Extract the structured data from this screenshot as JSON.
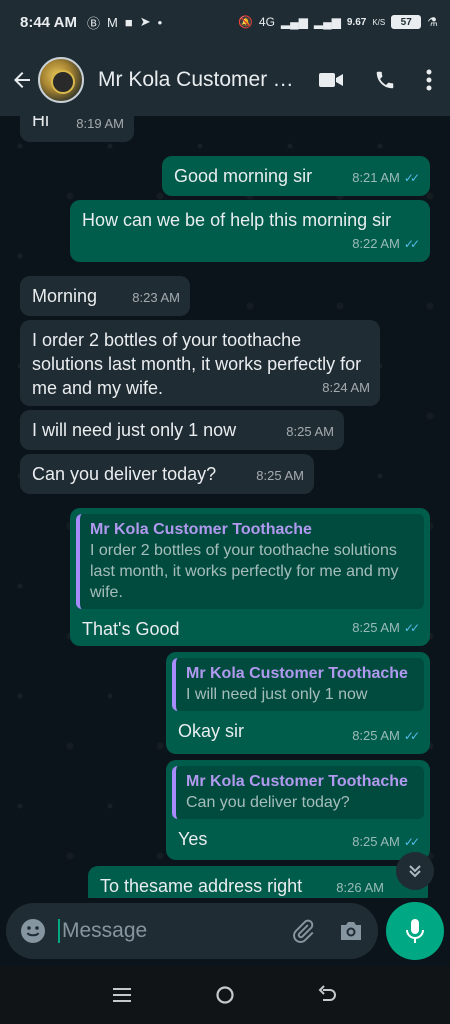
{
  "status_bar": {
    "time": "8:44 AM",
    "left_icons": [
      "b-icon",
      "gmail-icon",
      "square-icon",
      "telegram-icon",
      "dot-icon"
    ],
    "network_label": "4G",
    "speed_value": "9.67",
    "speed_unit": "K/S",
    "battery": "57"
  },
  "header": {
    "contact_name": "Mr Kola Customer Toothache",
    "icons": [
      "back-arrow-icon",
      "video-call-icon",
      "voice-call-icon",
      "more-options-icon"
    ]
  },
  "messages": [
    {
      "direction": "in",
      "text": "Hi",
      "time": "8:19 AM"
    },
    {
      "direction": "out",
      "text": "Good morning sir",
      "time": "8:21 AM",
      "read": true
    },
    {
      "direction": "out",
      "text": "How can we be of help this morning sir",
      "time": "8:22 AM",
      "read": true
    },
    {
      "direction": "in",
      "text": "Morning",
      "time": "8:23 AM"
    },
    {
      "direction": "in",
      "text": "I order 2 bottles of your toothache solutions last month, it works perfectly for me and my wife.",
      "time": "8:24 AM"
    },
    {
      "direction": "in",
      "text": "I will need just only 1 now",
      "time": "8:25 AM"
    },
    {
      "direction": "in",
      "text": "Can you deliver today?",
      "time": "8:25 AM"
    },
    {
      "direction": "out",
      "reply_to_name": "Mr Kola Customer Toothache",
      "reply_to_text": "I order 2 bottles of your toothache solutions last month, it works perfectly for me and my wife.",
      "text": "That's Good",
      "time": "8:25 AM",
      "read": true
    },
    {
      "direction": "out",
      "reply_to_name": "Mr Kola Customer Toothache",
      "reply_to_text": "I will need just only 1 now",
      "text": "Okay sir",
      "time": "8:25 AM",
      "read": true
    },
    {
      "direction": "out",
      "reply_to_name": "Mr Kola Customer Toothache",
      "reply_to_text": "Can you deliver today?",
      "text": "Yes",
      "time": "8:25 AM",
      "read": true
    },
    {
      "direction": "out",
      "text": "To thesame address right",
      "time": "8:26 AM",
      "read": false
    }
  ],
  "input": {
    "placeholder": "Message",
    "icons": [
      "emoji-icon",
      "attach-icon",
      "camera-icon",
      "mic-icon"
    ]
  },
  "colors": {
    "incoming_bubble": "#202c33",
    "outgoing_bubble": "#005c4b",
    "accent": "#00a884",
    "read_ticks": "#53bdeb",
    "quote_name": "#b199f0"
  }
}
